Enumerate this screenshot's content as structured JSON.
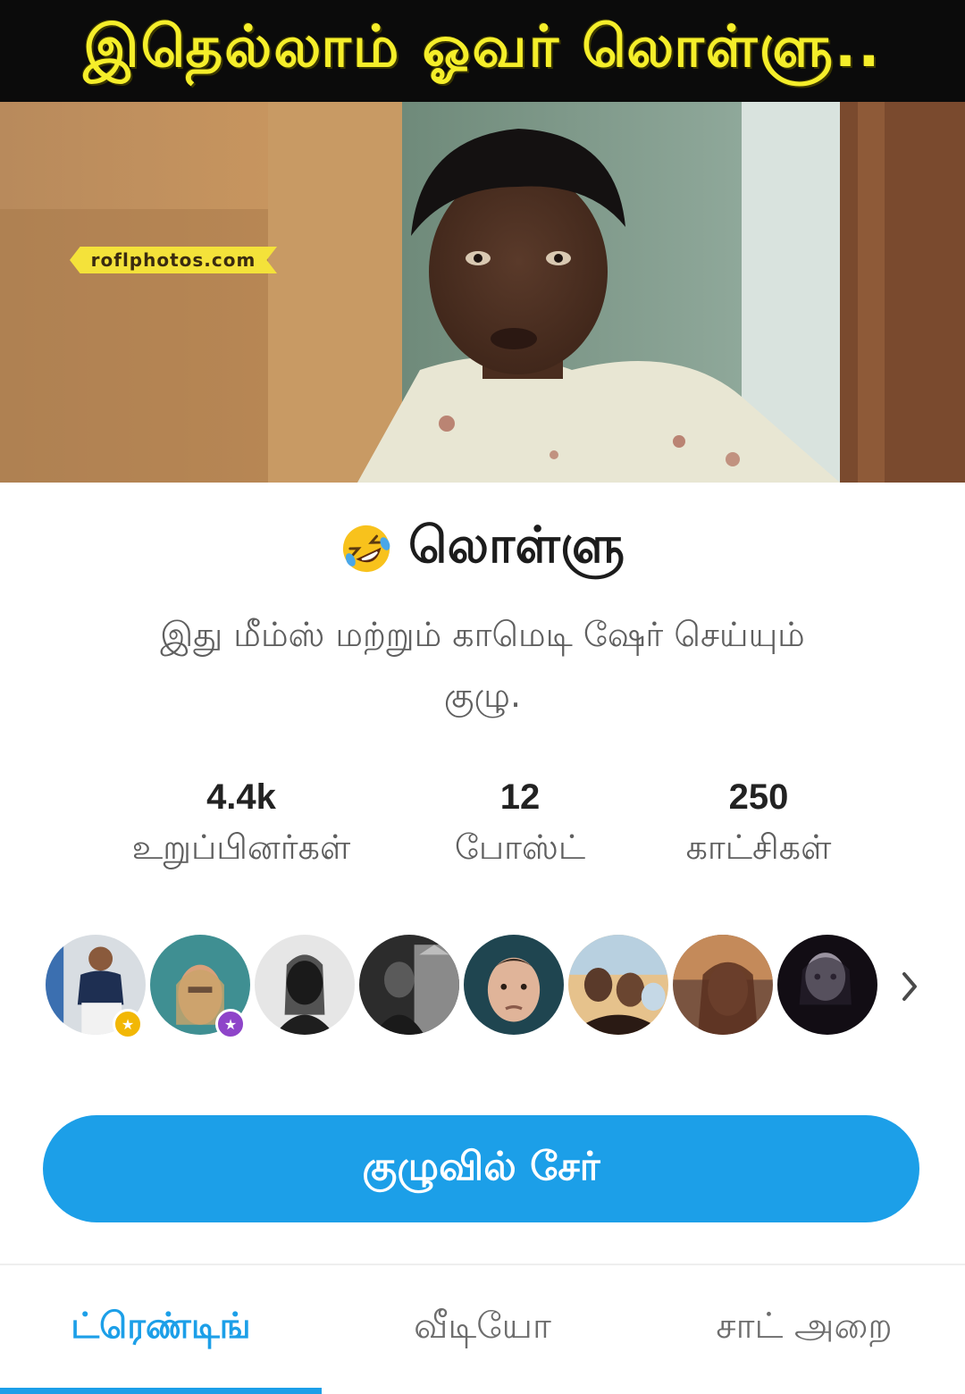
{
  "cover": {
    "caption": "இதெல்லாம் ஓவர் லொள்ளு..",
    "watermark": "roflphotos.com"
  },
  "group": {
    "emoji": "rolling-on-floor-laughing-icon",
    "name": "லொள்ளு",
    "description": "இது மீம்ஸ் மற்றும் காமெடி ஷேர் செய்யும் குழு."
  },
  "stats": [
    {
      "value": "4.4k",
      "label": "உறுப்பினர்கள்"
    },
    {
      "value": "12",
      "label": "போஸ்ட்"
    },
    {
      "value": "250",
      "label": "காட்சிகள்"
    }
  ],
  "members": {
    "badges": {
      "admin": "admin-badge-icon",
      "moderator": "moderator-badge-icon"
    },
    "more_icon": "chevron-right-icon"
  },
  "join_button": "குழுவில் சேர்",
  "tabs": [
    {
      "label": "ட்ரெண்டிங்",
      "active": true
    },
    {
      "label": "வீடியோ",
      "active": false
    },
    {
      "label": "சாட் அறை",
      "active": false
    }
  ],
  "colors": {
    "accent": "#1c9fe8",
    "caption_text": "#f5ee2a",
    "caption_bg": "#0b0b0b",
    "admin_badge": "#f2b705",
    "moderator_badge": "#8e44c9"
  }
}
